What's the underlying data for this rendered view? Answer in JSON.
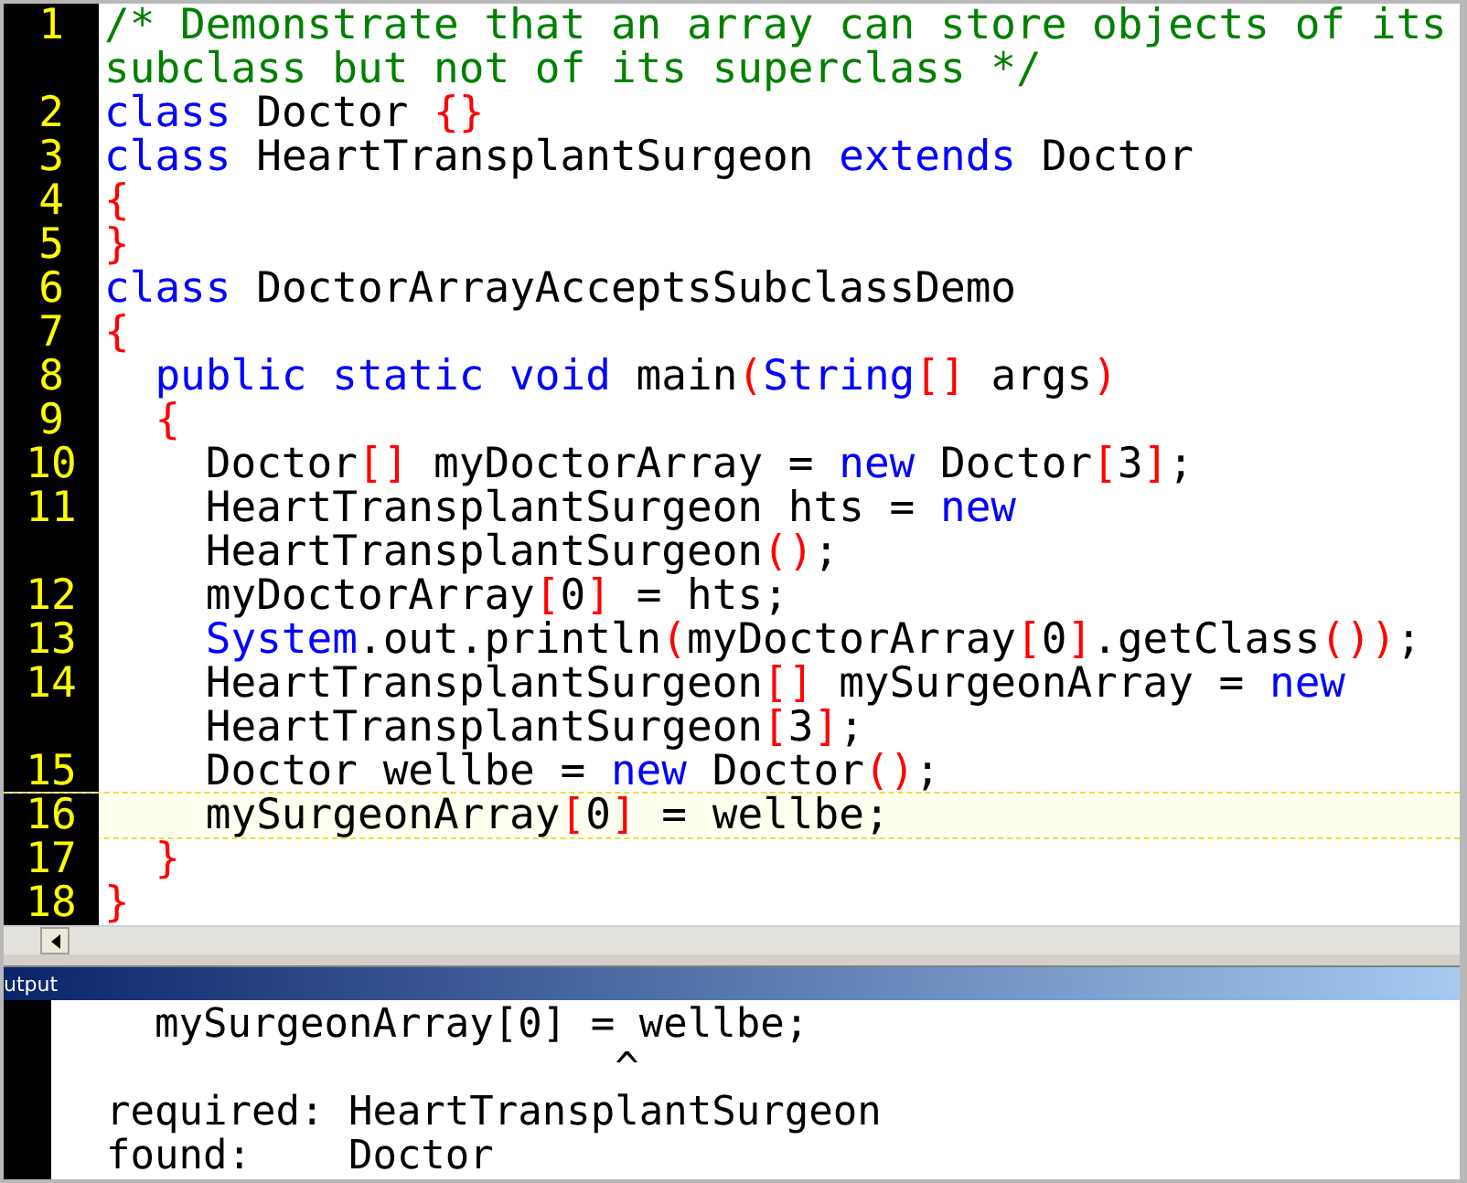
{
  "editor": {
    "lines": [
      {
        "number": "1",
        "current": false,
        "rows": [
          {
            "tokens": [
              {
                "kind": "comment",
                "text": "/* Demonstrate that an array can store objects of its"
              }
            ]
          },
          {
            "tokens": [
              {
                "kind": "comment",
                "text": "subclass but not of its superclass */"
              }
            ]
          }
        ]
      },
      {
        "number": "2",
        "current": false,
        "rows": [
          {
            "tokens": [
              {
                "kind": "keyword",
                "text": "class"
              },
              {
                "kind": "plain",
                "text": " Doctor "
              },
              {
                "kind": "bracket",
                "text": "{}"
              }
            ]
          }
        ]
      },
      {
        "number": "3",
        "current": false,
        "rows": [
          {
            "tokens": [
              {
                "kind": "keyword",
                "text": "class"
              },
              {
                "kind": "plain",
                "text": " HeartTransplantSurgeon "
              },
              {
                "kind": "keyword",
                "text": "extends"
              },
              {
                "kind": "plain",
                "text": " Doctor"
              }
            ]
          }
        ]
      },
      {
        "number": "4",
        "current": false,
        "rows": [
          {
            "tokens": [
              {
                "kind": "bracket",
                "text": "{"
              }
            ]
          }
        ]
      },
      {
        "number": "5",
        "current": false,
        "rows": [
          {
            "tokens": [
              {
                "kind": "bracket",
                "text": "}"
              }
            ]
          }
        ]
      },
      {
        "number": "6",
        "current": false,
        "rows": [
          {
            "tokens": [
              {
                "kind": "keyword",
                "text": "class"
              },
              {
                "kind": "plain",
                "text": " DoctorArrayAcceptsSubclassDemo"
              }
            ]
          }
        ]
      },
      {
        "number": "7",
        "current": false,
        "rows": [
          {
            "tokens": [
              {
                "kind": "bracket",
                "text": "{"
              }
            ]
          }
        ]
      },
      {
        "number": "8",
        "current": false,
        "rows": [
          {
            "tokens": [
              {
                "kind": "keyword",
                "text": "  public static void"
              },
              {
                "kind": "plain",
                "text": " main"
              },
              {
                "kind": "bracket",
                "text": "("
              },
              {
                "kind": "keyword",
                "text": "String"
              },
              {
                "kind": "bracket",
                "text": "[]"
              },
              {
                "kind": "plain",
                "text": " args"
              },
              {
                "kind": "bracket",
                "text": ")"
              }
            ]
          }
        ]
      },
      {
        "number": "9",
        "current": false,
        "rows": [
          {
            "tokens": [
              {
                "kind": "bracket",
                "text": "  {"
              }
            ]
          }
        ]
      },
      {
        "number": "10",
        "current": false,
        "rows": [
          {
            "tokens": [
              {
                "kind": "plain",
                "text": "    Doctor"
              },
              {
                "kind": "bracket",
                "text": "[]"
              },
              {
                "kind": "plain",
                "text": " myDoctorArray = "
              },
              {
                "kind": "keyword",
                "text": "new"
              },
              {
                "kind": "plain",
                "text": " Doctor"
              },
              {
                "kind": "bracket",
                "text": "["
              },
              {
                "kind": "plain",
                "text": "3"
              },
              {
                "kind": "bracket",
                "text": "]"
              },
              {
                "kind": "plain",
                "text": ";"
              }
            ]
          }
        ]
      },
      {
        "number": "11",
        "current": false,
        "rows": [
          {
            "tokens": [
              {
                "kind": "plain",
                "text": "    HeartTransplantSurgeon hts = "
              },
              {
                "kind": "keyword",
                "text": "new"
              }
            ]
          },
          {
            "tokens": [
              {
                "kind": "plain",
                "text": "    HeartTransplantSurgeon"
              },
              {
                "kind": "bracket",
                "text": "()"
              },
              {
                "kind": "plain",
                "text": ";"
              }
            ]
          }
        ]
      },
      {
        "number": "12",
        "current": false,
        "rows": [
          {
            "tokens": [
              {
                "kind": "plain",
                "text": "    myDoctorArray"
              },
              {
                "kind": "bracket",
                "text": "["
              },
              {
                "kind": "plain",
                "text": "0"
              },
              {
                "kind": "bracket",
                "text": "]"
              },
              {
                "kind": "plain",
                "text": " = hts;"
              }
            ]
          }
        ]
      },
      {
        "number": "13",
        "current": false,
        "rows": [
          {
            "tokens": [
              {
                "kind": "keyword",
                "text": "    System"
              },
              {
                "kind": "plain",
                "text": ".out.println"
              },
              {
                "kind": "bracket",
                "text": "("
              },
              {
                "kind": "plain",
                "text": "myDoctorArray"
              },
              {
                "kind": "bracket",
                "text": "["
              },
              {
                "kind": "plain",
                "text": "0"
              },
              {
                "kind": "bracket",
                "text": "]"
              },
              {
                "kind": "plain",
                "text": ".getClass"
              },
              {
                "kind": "bracket",
                "text": "())"
              },
              {
                "kind": "plain",
                "text": ";"
              }
            ]
          }
        ]
      },
      {
        "number": "14",
        "current": false,
        "rows": [
          {
            "tokens": [
              {
                "kind": "plain",
                "text": "    HeartTransplantSurgeon"
              },
              {
                "kind": "bracket",
                "text": "[]"
              },
              {
                "kind": "plain",
                "text": " mySurgeonArray = "
              },
              {
                "kind": "keyword",
                "text": "new"
              }
            ]
          },
          {
            "tokens": [
              {
                "kind": "plain",
                "text": "    HeartTransplantSurgeon"
              },
              {
                "kind": "bracket",
                "text": "["
              },
              {
                "kind": "plain",
                "text": "3"
              },
              {
                "kind": "bracket",
                "text": "]"
              },
              {
                "kind": "plain",
                "text": ";"
              }
            ]
          }
        ]
      },
      {
        "number": "15",
        "current": false,
        "rows": [
          {
            "tokens": [
              {
                "kind": "plain",
                "text": "    Doctor wellbe = "
              },
              {
                "kind": "keyword",
                "text": "new"
              },
              {
                "kind": "plain",
                "text": " Doctor"
              },
              {
                "kind": "bracket",
                "text": "()"
              },
              {
                "kind": "plain",
                "text": ";"
              }
            ]
          }
        ]
      },
      {
        "number": "16",
        "current": true,
        "rows": [
          {
            "tokens": [
              {
                "kind": "plain",
                "text": "    mySurgeonArray"
              },
              {
                "kind": "bracket",
                "text": "["
              },
              {
                "kind": "plain",
                "text": "0"
              },
              {
                "kind": "bracket",
                "text": "]"
              },
              {
                "kind": "plain",
                "text": " = wellbe;"
              }
            ]
          }
        ]
      },
      {
        "number": "17",
        "current": false,
        "rows": [
          {
            "tokens": [
              {
                "kind": "bracket",
                "text": "  }"
              }
            ]
          }
        ]
      },
      {
        "number": "18",
        "current": false,
        "rows": [
          {
            "tokens": [
              {
                "kind": "bracket",
                "text": "}"
              }
            ]
          }
        ]
      }
    ]
  },
  "output": {
    "title": "utput",
    "lines": [
      "  mySurgeonArray[0] = wellbe;",
      "                     ^",
      "required: HeartTransplantSurgeon",
      "found:    Doctor"
    ]
  }
}
